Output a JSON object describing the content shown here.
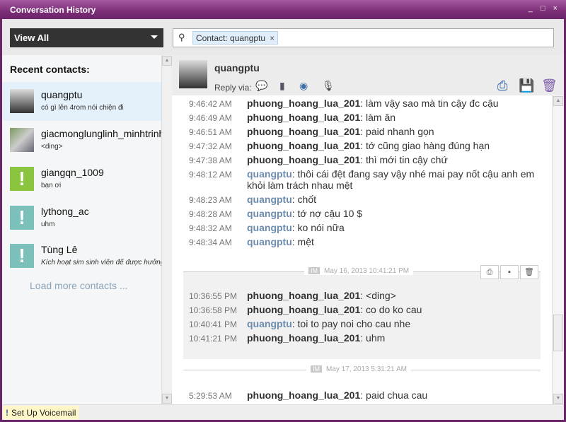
{
  "window": {
    "title": "Conversation History",
    "controls": "_ □ ×"
  },
  "toolbar": {
    "view_select": "View All",
    "search_chip": "Contact: quangptu",
    "chip_close": "×",
    "search_icon": "⚲"
  },
  "sidebar": {
    "heading": "Recent contacts:",
    "load_more": "Load more contacts ...",
    "contacts": [
      {
        "name": "quangptu",
        "last": "có gì lên 4rom nói chiện đi"
      },
      {
        "name": "giacmonglunglinh_minhtrinh",
        "last": "<ding>"
      },
      {
        "name": "giangqn_1009",
        "last": "bạn ơi"
      },
      {
        "name": "lythong_ac",
        "last": "uhm"
      },
      {
        "name": "Tùng Lê",
        "last": "Kích hoạt sim sinh viên để được hưởng"
      }
    ]
  },
  "conversation": {
    "contact": "quangptu",
    "reply_via": "Reply via:",
    "messages1": [
      {
        "time": "9:46:42 AM",
        "from": "phuong_hoang_lua_201",
        "text": ": làm vậy sao mà tin cậy đc cậu"
      },
      {
        "time": "9:46:49 AM",
        "from": "phuong_hoang_lua_201",
        "text": ": làm ăn"
      },
      {
        "time": "9:46:51 AM",
        "from": "phuong_hoang_lua_201",
        "text": ": paid nhanh gọn"
      },
      {
        "time": "9:47:32 AM",
        "from": "phuong_hoang_lua_201",
        "text": ": tớ cũng giao hàng đúng hạn"
      },
      {
        "time": "9:47:38 AM",
        "from": "phuong_hoang_lua_201",
        "text": ": thì mới tin cậy chứ"
      },
      {
        "time": "9:48:12 AM",
        "from": "quangptu",
        "text": ": thôi cái đệt đang say vậy nhé mai pay nốt cậu anh em khỏi làm trách nhau mệt"
      },
      {
        "time": "9:48:23 AM",
        "from": "quangptu",
        "text": ": chốt"
      },
      {
        "time": "9:48:28 AM",
        "from": "quangptu",
        "text": ": tớ nợ cậu 10 $"
      },
      {
        "time": "9:48:32 AM",
        "from": "quangptu",
        "text": ": ko nói nữa"
      },
      {
        "time": "9:48:34 AM",
        "from": "quangptu",
        "text": ": mệt"
      }
    ],
    "session2": {
      "badge": "IM",
      "date": "May 16, 2013 10:41:21 PM"
    },
    "messages2": [
      {
        "time": "10:36:55 PM",
        "from": "phuong_hoang_lua_201",
        "text": ": <ding>"
      },
      {
        "time": "10:36:58 PM",
        "from": "phuong_hoang_lua_201",
        "text": ": co do ko cau"
      },
      {
        "time": "10:40:41 PM",
        "from": "quangptu",
        "text": ": toi to pay noi cho cau nhe"
      },
      {
        "time": "10:41:21 PM",
        "from": "phuong_hoang_lua_201",
        "text": ": uhm"
      }
    ],
    "session3": {
      "badge": "IM",
      "date": "May 17, 2013 5:31:21 AM"
    },
    "messages3": [
      {
        "time": "5:29:53 AM",
        "from": "phuong_hoang_lua_201",
        "text": ": paid chua cau"
      }
    ]
  },
  "status": {
    "voicemail": "Set Up Voicemail"
  }
}
